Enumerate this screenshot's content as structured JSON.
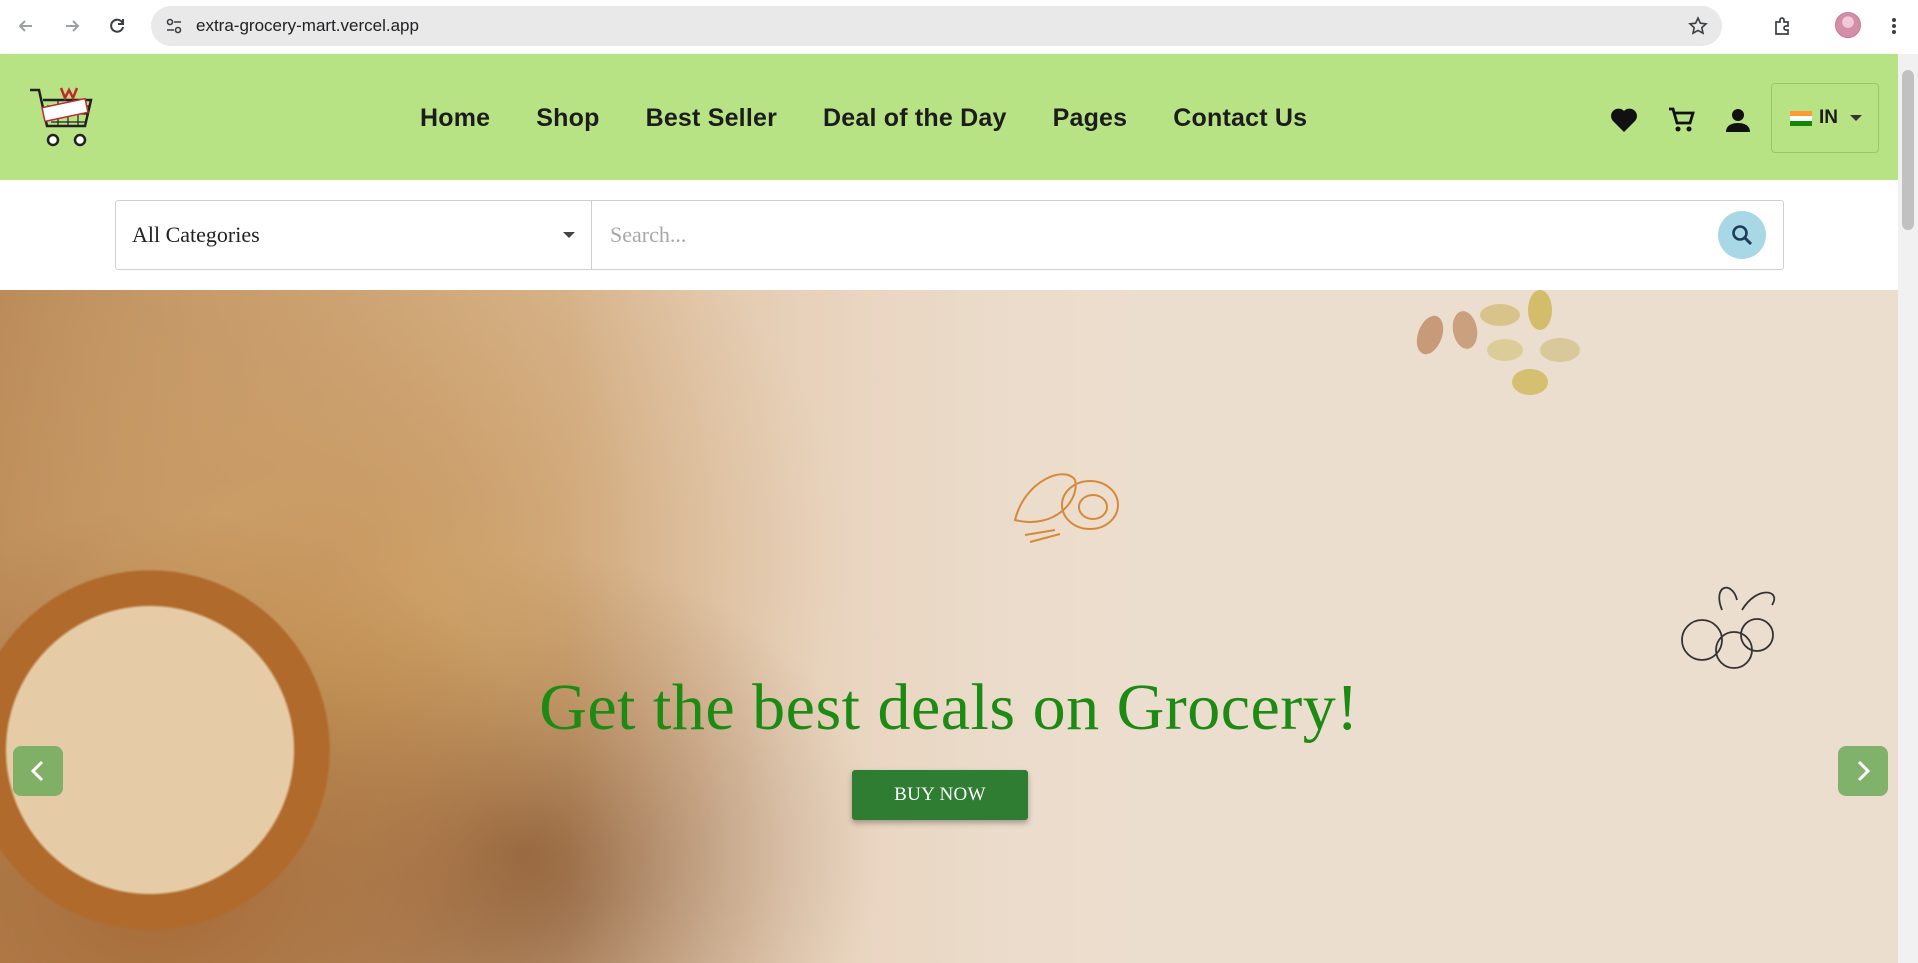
{
  "browser": {
    "url": "extra-grocery-mart.vercel.app"
  },
  "header": {
    "logo_alt": "ExtraW",
    "menu": [
      {
        "label": "Home"
      },
      {
        "label": "Shop"
      },
      {
        "label": "Best Seller"
      },
      {
        "label": "Deal of the Day"
      },
      {
        "label": "Pages"
      },
      {
        "label": "Contact Us"
      }
    ],
    "country_code": "IN",
    "bg_color": "#b7e384"
  },
  "search": {
    "category_selected": "All Categories",
    "placeholder": "Search..."
  },
  "hero": {
    "title": "Get the best deals on Grocery!",
    "button_label": "BUY NOW",
    "title_color": "#1d8a14",
    "button_color": "#2e7d32"
  }
}
